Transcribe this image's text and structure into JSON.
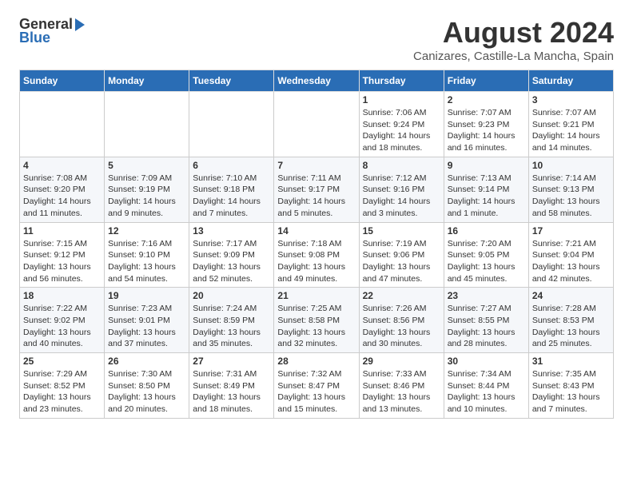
{
  "logo": {
    "general": "General",
    "blue": "Blue"
  },
  "title": "August 2024",
  "subtitle": "Canizares, Castille-La Mancha, Spain",
  "days_of_week": [
    "Sunday",
    "Monday",
    "Tuesday",
    "Wednesday",
    "Thursday",
    "Friday",
    "Saturday"
  ],
  "weeks": [
    [
      {
        "day": "",
        "info": ""
      },
      {
        "day": "",
        "info": ""
      },
      {
        "day": "",
        "info": ""
      },
      {
        "day": "",
        "info": ""
      },
      {
        "day": "1",
        "info": "Sunrise: 7:06 AM\nSunset: 9:24 PM\nDaylight: 14 hours\nand 18 minutes."
      },
      {
        "day": "2",
        "info": "Sunrise: 7:07 AM\nSunset: 9:23 PM\nDaylight: 14 hours\nand 16 minutes."
      },
      {
        "day": "3",
        "info": "Sunrise: 7:07 AM\nSunset: 9:21 PM\nDaylight: 14 hours\nand 14 minutes."
      }
    ],
    [
      {
        "day": "4",
        "info": "Sunrise: 7:08 AM\nSunset: 9:20 PM\nDaylight: 14 hours\nand 11 minutes."
      },
      {
        "day": "5",
        "info": "Sunrise: 7:09 AM\nSunset: 9:19 PM\nDaylight: 14 hours\nand 9 minutes."
      },
      {
        "day": "6",
        "info": "Sunrise: 7:10 AM\nSunset: 9:18 PM\nDaylight: 14 hours\nand 7 minutes."
      },
      {
        "day": "7",
        "info": "Sunrise: 7:11 AM\nSunset: 9:17 PM\nDaylight: 14 hours\nand 5 minutes."
      },
      {
        "day": "8",
        "info": "Sunrise: 7:12 AM\nSunset: 9:16 PM\nDaylight: 14 hours\nand 3 minutes."
      },
      {
        "day": "9",
        "info": "Sunrise: 7:13 AM\nSunset: 9:14 PM\nDaylight: 14 hours\nand 1 minute."
      },
      {
        "day": "10",
        "info": "Sunrise: 7:14 AM\nSunset: 9:13 PM\nDaylight: 13 hours\nand 58 minutes."
      }
    ],
    [
      {
        "day": "11",
        "info": "Sunrise: 7:15 AM\nSunset: 9:12 PM\nDaylight: 13 hours\nand 56 minutes."
      },
      {
        "day": "12",
        "info": "Sunrise: 7:16 AM\nSunset: 9:10 PM\nDaylight: 13 hours\nand 54 minutes."
      },
      {
        "day": "13",
        "info": "Sunrise: 7:17 AM\nSunset: 9:09 PM\nDaylight: 13 hours\nand 52 minutes."
      },
      {
        "day": "14",
        "info": "Sunrise: 7:18 AM\nSunset: 9:08 PM\nDaylight: 13 hours\nand 49 minutes."
      },
      {
        "day": "15",
        "info": "Sunrise: 7:19 AM\nSunset: 9:06 PM\nDaylight: 13 hours\nand 47 minutes."
      },
      {
        "day": "16",
        "info": "Sunrise: 7:20 AM\nSunset: 9:05 PM\nDaylight: 13 hours\nand 45 minutes."
      },
      {
        "day": "17",
        "info": "Sunrise: 7:21 AM\nSunset: 9:04 PM\nDaylight: 13 hours\nand 42 minutes."
      }
    ],
    [
      {
        "day": "18",
        "info": "Sunrise: 7:22 AM\nSunset: 9:02 PM\nDaylight: 13 hours\nand 40 minutes."
      },
      {
        "day": "19",
        "info": "Sunrise: 7:23 AM\nSunset: 9:01 PM\nDaylight: 13 hours\nand 37 minutes."
      },
      {
        "day": "20",
        "info": "Sunrise: 7:24 AM\nSunset: 8:59 PM\nDaylight: 13 hours\nand 35 minutes."
      },
      {
        "day": "21",
        "info": "Sunrise: 7:25 AM\nSunset: 8:58 PM\nDaylight: 13 hours\nand 32 minutes."
      },
      {
        "day": "22",
        "info": "Sunrise: 7:26 AM\nSunset: 8:56 PM\nDaylight: 13 hours\nand 30 minutes."
      },
      {
        "day": "23",
        "info": "Sunrise: 7:27 AM\nSunset: 8:55 PM\nDaylight: 13 hours\nand 28 minutes."
      },
      {
        "day": "24",
        "info": "Sunrise: 7:28 AM\nSunset: 8:53 PM\nDaylight: 13 hours\nand 25 minutes."
      }
    ],
    [
      {
        "day": "25",
        "info": "Sunrise: 7:29 AM\nSunset: 8:52 PM\nDaylight: 13 hours\nand 23 minutes."
      },
      {
        "day": "26",
        "info": "Sunrise: 7:30 AM\nSunset: 8:50 PM\nDaylight: 13 hours\nand 20 minutes."
      },
      {
        "day": "27",
        "info": "Sunrise: 7:31 AM\nSunset: 8:49 PM\nDaylight: 13 hours\nand 18 minutes."
      },
      {
        "day": "28",
        "info": "Sunrise: 7:32 AM\nSunset: 8:47 PM\nDaylight: 13 hours\nand 15 minutes."
      },
      {
        "day": "29",
        "info": "Sunrise: 7:33 AM\nSunset: 8:46 PM\nDaylight: 13 hours\nand 13 minutes."
      },
      {
        "day": "30",
        "info": "Sunrise: 7:34 AM\nSunset: 8:44 PM\nDaylight: 13 hours\nand 10 minutes."
      },
      {
        "day": "31",
        "info": "Sunrise: 7:35 AM\nSunset: 8:43 PM\nDaylight: 13 hours\nand 7 minutes."
      }
    ]
  ]
}
